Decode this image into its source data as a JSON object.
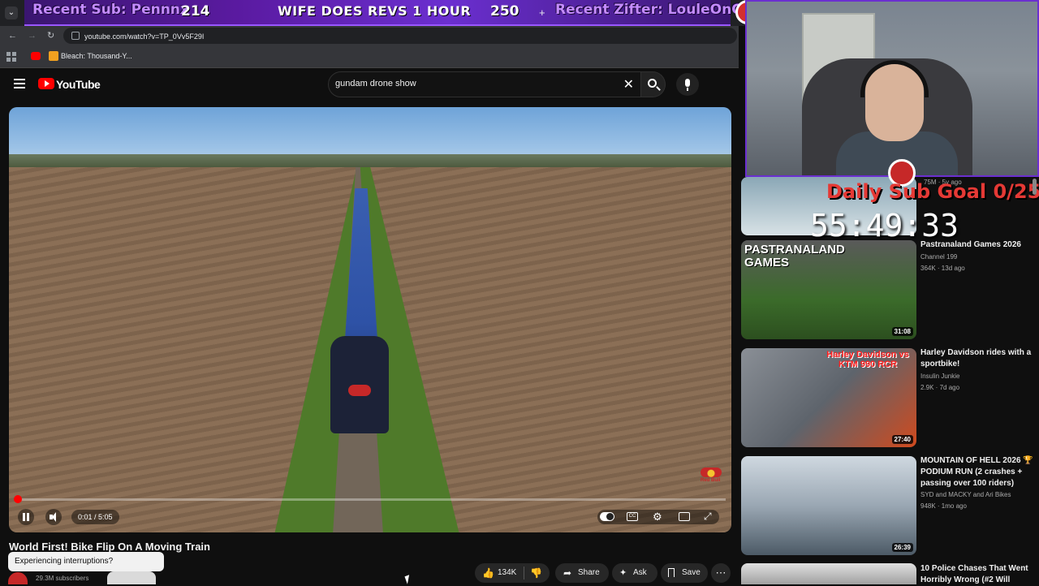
{
  "browser": {
    "url": "youtube.com/watch?v=TP_0Vv5F29I",
    "bookmark_label": "Bleach: Thousand-Y..."
  },
  "stream_overlay": {
    "recent_sub": "Recent Sub: Pennnx",
    "counter_left": "214",
    "goal_text": "WIFE DOES REVS 1 HOUR",
    "counter_right": "250",
    "recent_tipper": "Recent Zifter: LouleOnGas",
    "daily_goal": "Daily Sub Goal 0/25",
    "timer": "55:49:33"
  },
  "youtube": {
    "logo_text": "YouTube",
    "search_value": "gundam drone show",
    "video": {
      "time": "0:01 / 5:05",
      "progress": 0.003,
      "watermark": "Red Bull",
      "title": "World First! Bike Flip On A Moving Train",
      "subscribers": "29.3M subscribers"
    },
    "toast": "Experiencing interruptions?",
    "actions": {
      "likes": "134K",
      "share": "Share",
      "ask": "Ask",
      "save": "Save"
    },
    "related": [
      {
        "title": "Pastranaland Games 2026",
        "channel": "Channel 199",
        "meta": "364K · 13d ago",
        "duration": "31:08",
        "thumb_text": "PASTRANALAND GAMES"
      },
      {
        "title": "Harley Davidson rides with a sportbike!",
        "channel": "Insulin Junkie",
        "meta": "2.9K · 7d ago",
        "duration": "27:40",
        "thumb_text": "Harley Davidson vs KTM 990 RCR"
      },
      {
        "title": "MOUNTAIN OF HELL 2026 🏆 PODIUM RUN (2 crashes + passing over 100 riders)",
        "channel": "SYD and MACKY and Ari Bikes",
        "meta": "948K · 1mo ago",
        "duration": "26:39",
        "thumb_text": ""
      },
      {
        "title": "10 Police Chases That Went Horribly Wrong (#2 Will",
        "channel": "",
        "meta": "",
        "duration": "",
        "thumb_text": ""
      }
    ],
    "top_partial_meta": "75M · 5y ago"
  }
}
